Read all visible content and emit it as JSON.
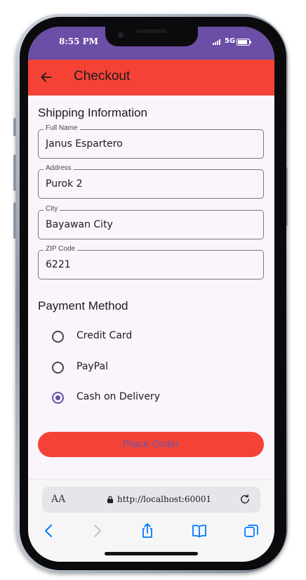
{
  "status_bar": {
    "time": "8:55 PM",
    "network": "5G"
  },
  "app_bar": {
    "title": "Checkout"
  },
  "shipping": {
    "title": "Shipping Information",
    "fields": [
      {
        "label": "Full Name",
        "value": "Janus Espartero"
      },
      {
        "label": "Address",
        "value": "Purok 2"
      },
      {
        "label": "City",
        "value": "Bayawan City"
      },
      {
        "label": "ZIP Code",
        "value": "6221"
      }
    ]
  },
  "payment": {
    "title": "Payment Method",
    "options": [
      {
        "label": "Credit Card",
        "selected": false
      },
      {
        "label": "PayPal",
        "selected": false
      },
      {
        "label": "Cash on Delivery",
        "selected": true
      }
    ]
  },
  "place_order_label": "Place Order",
  "browser": {
    "aa_label": "AA",
    "url": "http://localhost:60001",
    "icons": [
      "back-icon",
      "forward-icon",
      "share-icon",
      "bookmarks-icon",
      "tabs-icon",
      "lock-icon",
      "reload-icon"
    ]
  },
  "colors": {
    "status_bar": "#6b4ea6",
    "app_bar": "#f44336",
    "accent": "#6750a4",
    "background": "#faf4fb",
    "ios_blue": "#007aff"
  }
}
